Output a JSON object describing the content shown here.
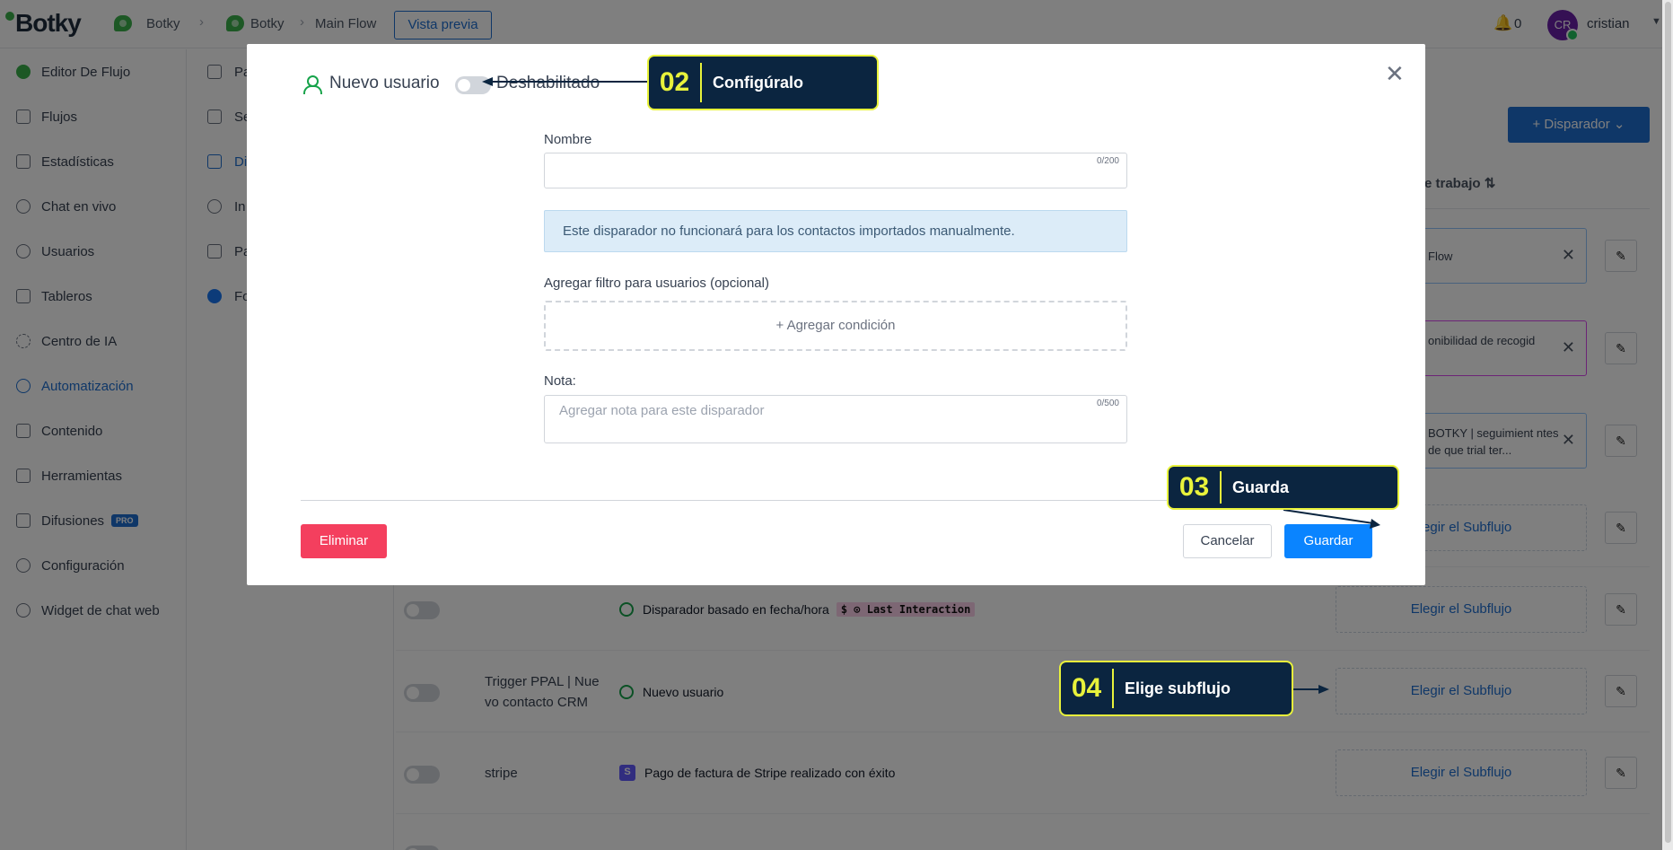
{
  "brand": {
    "name": "Botky"
  },
  "breadcrumb": {
    "items": [
      "Botky",
      "Botky",
      "Main Flow"
    ],
    "preview_label": "Vista previa"
  },
  "header": {
    "notifications": "0",
    "avatar_initials": "CR",
    "user_name": "cristian"
  },
  "sidebar": {
    "items": [
      {
        "label": "Editor De Flujo"
      },
      {
        "label": "Flujos"
      },
      {
        "label": "Estadísticas"
      },
      {
        "label": "Chat en vivo"
      },
      {
        "label": "Usuarios"
      },
      {
        "label": "Tableros"
      },
      {
        "label": "Centro de IA"
      },
      {
        "label": "Automatización",
        "active": true
      },
      {
        "label": "Contenido"
      },
      {
        "label": "Herramientas"
      },
      {
        "label": "Difusiones",
        "badge": "PRO"
      },
      {
        "label": "Configuración"
      },
      {
        "label": "Widget de chat web"
      }
    ]
  },
  "subsidebar": {
    "items": [
      "Pa",
      "Se",
      "Di",
      "In",
      "Pa",
      "Fo"
    ]
  },
  "main": {
    "add_trigger_label": "+ Disparador",
    "column_header": "e trabajo",
    "chips": [
      "Flow",
      "onibilidad de recogid",
      "BOTKY | seguimient ntes de que trial ter..."
    ],
    "choose_subflow": "Elegir el Subflujo",
    "rows": [
      {
        "name": "",
        "trigger": "Disparador basado en fecha/hora",
        "badge": "Last Interaction"
      },
      {
        "name": "Trigger PPAL | Nue vo contacto CRM",
        "trigger": "Nuevo usuario"
      },
      {
        "name": "stripe",
        "trigger": "Pago de factura de Stripe realizado con éxito",
        "icon_text": "S"
      }
    ]
  },
  "modal": {
    "title": "Nuevo usuario",
    "toggle_label": "Deshabilitado",
    "name_label": "Nombre",
    "name_value": "",
    "name_counter": "0/200",
    "info_text": "Este disparador no funcionará para los contactos importados manualmente.",
    "filter_label": "Agregar filtro para usuarios (opcional)",
    "add_condition": "+ Agregar condición",
    "note_label": "Nota:",
    "note_placeholder": "Agregar nota para este disparador",
    "note_counter": "0/500",
    "delete_label": "Eliminar",
    "cancel_label": "Cancelar",
    "save_label": "Guardar"
  },
  "callouts": [
    {
      "num": "02",
      "text": "Configúralo"
    },
    {
      "num": "03",
      "text": "Guarda"
    },
    {
      "num": "04",
      "text": "Elige subflujo"
    }
  ],
  "colors": {
    "accent": "#1f6fd1",
    "callout_bg": "#0b2540",
    "callout_border": "#e8f23b",
    "danger": "#f43f5e",
    "save": "#0a84ff"
  }
}
